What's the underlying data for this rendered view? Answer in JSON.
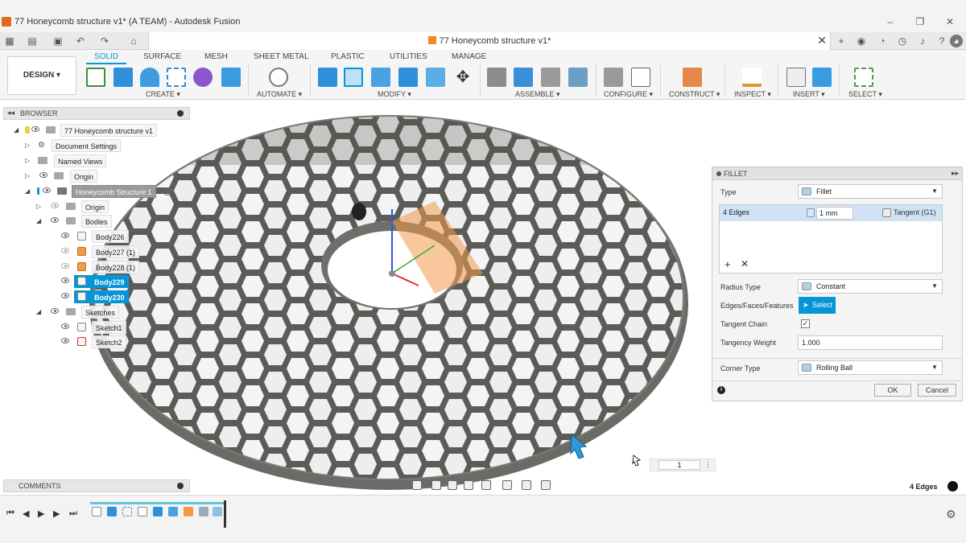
{
  "window": {
    "title": "77 Honeycomb structure v1* (A TEAM) - Autodesk Fusion",
    "minimize": "–",
    "restore": "❐",
    "close": "✕"
  },
  "document_tab": {
    "title": "77 Honeycomb structure v1*",
    "close": "✕"
  },
  "ribbon": {
    "design_label": "DESIGN ▾",
    "tabs": [
      "SOLID",
      "SURFACE",
      "MESH",
      "SHEET METAL",
      "PLASTIC",
      "UTILITIES",
      "MANAGE"
    ],
    "active_tab": "SOLID",
    "groups": [
      "CREATE ▾",
      "AUTOMATE ▾",
      "MODIFY ▾",
      "ASSEMBLE ▾",
      "CONFIGURE ▾",
      "CONSTRUCT ▾",
      "INSPECT ▾",
      "INSERT ▾",
      "SELECT ▾"
    ]
  },
  "browser": {
    "title": "BROWSER",
    "items": [
      {
        "label": "77 Honeycomb structure v1"
      },
      {
        "label": "Document Settings"
      },
      {
        "label": "Named Views"
      },
      {
        "label": "Origin"
      },
      {
        "label": "Honeycomb Structure:1"
      },
      {
        "label": "Origin"
      },
      {
        "label": "Bodies"
      },
      {
        "label": "Body226"
      },
      {
        "label": "Body227 (1)"
      },
      {
        "label": "Body228 (1)"
      },
      {
        "label": "Body229"
      },
      {
        "label": "Body230"
      },
      {
        "label": "Sketches"
      },
      {
        "label": "Sketch1"
      },
      {
        "label": "Sketch2"
      }
    ]
  },
  "fillet": {
    "title": "FILLET",
    "type_label": "Type",
    "type_value": "Fillet",
    "edges_label": "4 Edges",
    "radius_value": "1 mm",
    "continuity_value": "Tangent (G1)",
    "add_icon": "+",
    "remove_icon": "✕",
    "radius_type_label": "Radius Type",
    "radius_type_value": "Constant",
    "selection_label": "Edges/Faces/Features",
    "select_button": "Select",
    "tangent_chain_label": "Tangent Chain",
    "tangent_chain_checked": "✓",
    "tangency_weight_label": "Tangency Weight",
    "tangency_weight_value": "1.000",
    "corner_type_label": "Corner Type",
    "corner_type_value": "Rolling Ball",
    "ok": "OK",
    "cancel": "Cancel"
  },
  "comments": {
    "title": "COMMENTS"
  },
  "pager": {
    "value": "1",
    "menu": "⋮"
  },
  "status": {
    "selection_count": "4 Edges"
  },
  "colors": {
    "accent": "#0696d7",
    "honeycomb": "#5b5b57",
    "body_orange": "#f39a4a"
  }
}
